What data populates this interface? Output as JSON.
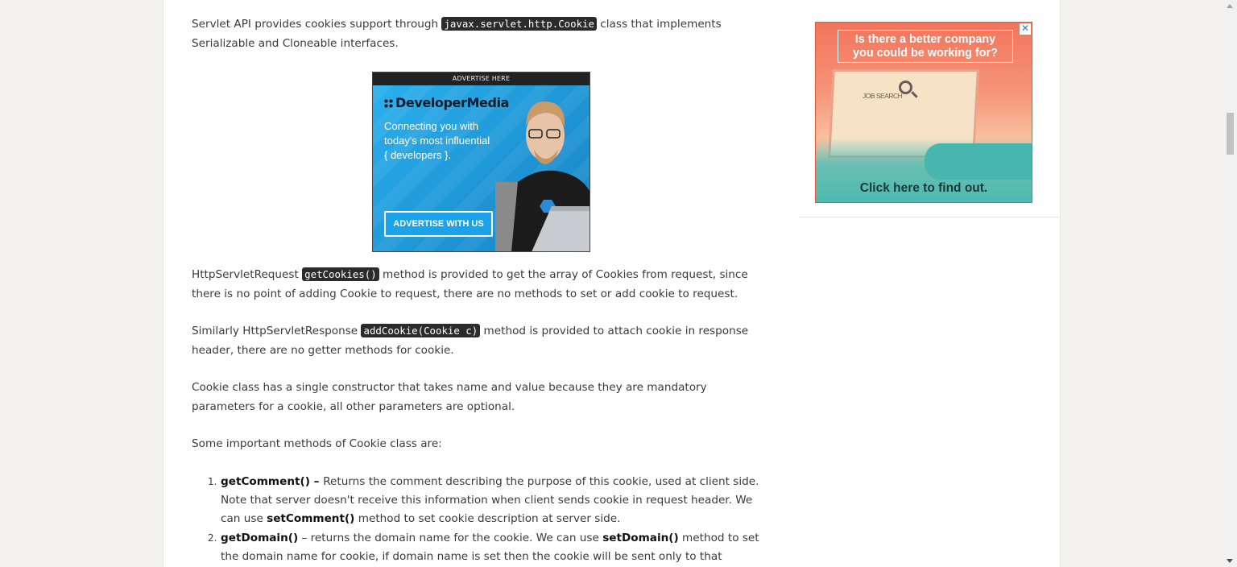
{
  "article": {
    "p1": {
      "before": "Servlet API provides cookies support through ",
      "code": "javax.servlet.http.Cookie",
      "after": " class that implements Serializable and Cloneable interfaces."
    },
    "p2": {
      "before": "HttpServletRequest ",
      "code": "getCookies()",
      "after": " method is provided to get the array of Cookies from request, since there is no point of adding Cookie to request, there are no methods to set or add cookie to request."
    },
    "p3": {
      "before": "Similarly HttpServletResponse ",
      "code": "addCookie(Cookie c)",
      "after": " method is provided to attach cookie in response header, there are no getter methods for cookie."
    },
    "p4": "Cookie class has a single constructor that takes name and value because they are mandatory parameters for a cookie, all other parameters are optional.",
    "p5": "Some important methods of Cookie class are:",
    "methods": [
      {
        "num": "1.",
        "name": "getComment()",
        "sep": " – ",
        "desc": "Returns the comment describing the purpose of this cookie, used at client side. Note that server doesn't receive this information when client sends cookie in request header. We can use ",
        "ref": "setComment()",
        "tail": " method to set cookie description at server side."
      },
      {
        "num": "2.",
        "name": "getDomain()",
        "sep": " – ",
        "desc": "returns the domain name for the cookie. We can use ",
        "ref": "setDomain()",
        "tail": " method to set the domain name for cookie, if domain name is set then the cookie will be sent only to that particular"
      }
    ]
  },
  "ad_inline": {
    "top_label": "ADVERTISE HERE",
    "brand": "DeveloperMedia",
    "tagline_1": "Connecting you with",
    "tagline_2": "today's most influential",
    "tagline_3": "{ developers }.",
    "button": "ADVERTISE WITH US",
    "accent": "#29a8e6"
  },
  "ad_sidebar": {
    "headline_1": "Is there a better company",
    "headline_2": "you could be working for?",
    "screen_text": "JOB SEARCH",
    "cta": "Click here to find out.",
    "close": "✕",
    "accent": "#f2745b"
  }
}
